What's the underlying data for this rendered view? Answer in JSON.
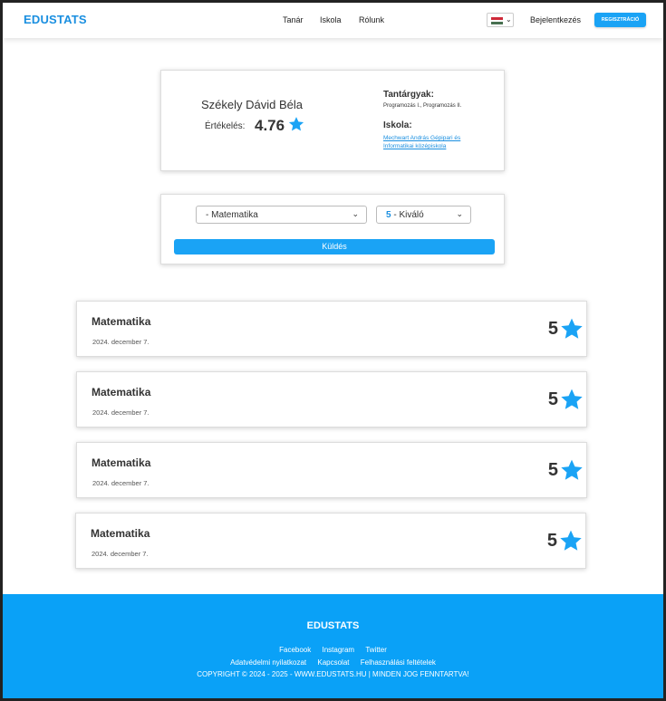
{
  "navbar": {
    "brand": "EDUSTATS",
    "links": [
      "Tanár",
      "Iskola",
      "Rólunk"
    ],
    "login": "Bejelentkezés",
    "register": "REGISZTRÁCIÓ",
    "language_icon": "hungary-flag-icon",
    "flag_colors": [
      "#ce2939",
      "#ffffff",
      "#477050"
    ]
  },
  "teacher": {
    "name": "Székely Dávid Béla",
    "rating_label": "Értékelés:",
    "rating_value": "4.76",
    "subjects_title": "Tantárgyak:",
    "subjects_value": "Programozás I., Programozás II.",
    "school_title": "Iskola:",
    "school_value": "Mechwart András Gépipari és Informatikai középiskola"
  },
  "form": {
    "subject_select": "- Matematika",
    "grade_number": "5",
    "grade_label": " - Kiváló",
    "submit": "Küldés"
  },
  "reviews": [
    {
      "subject": "Matematika",
      "date": "2024. december 7.",
      "grade": "5"
    },
    {
      "subject": "Matematika",
      "date": "2024. december 7.",
      "grade": "5"
    },
    {
      "subject": "Matematika",
      "date": "2024. december 7.",
      "grade": "5"
    },
    {
      "subject": "Matematika",
      "date": "2024. december 7.",
      "grade": "5"
    }
  ],
  "footer": {
    "brand": "EDUSTATS",
    "social": [
      "Facebook",
      "Instagram",
      "Twitter"
    ],
    "legal": [
      "Adatvédelmi nyilatkozat",
      "Kapcsolat",
      "Felhasználási feltételek"
    ],
    "copyright": "COPYRIGHT © 2024 - 2025 - WWW.EDUSTATS.HU | MINDEN JOG FENNTARTVA!"
  },
  "colors": {
    "accent": "#1aa3f5",
    "brand": "#1a8fe0",
    "footer": "#0aa1f7",
    "text": "#333333"
  }
}
